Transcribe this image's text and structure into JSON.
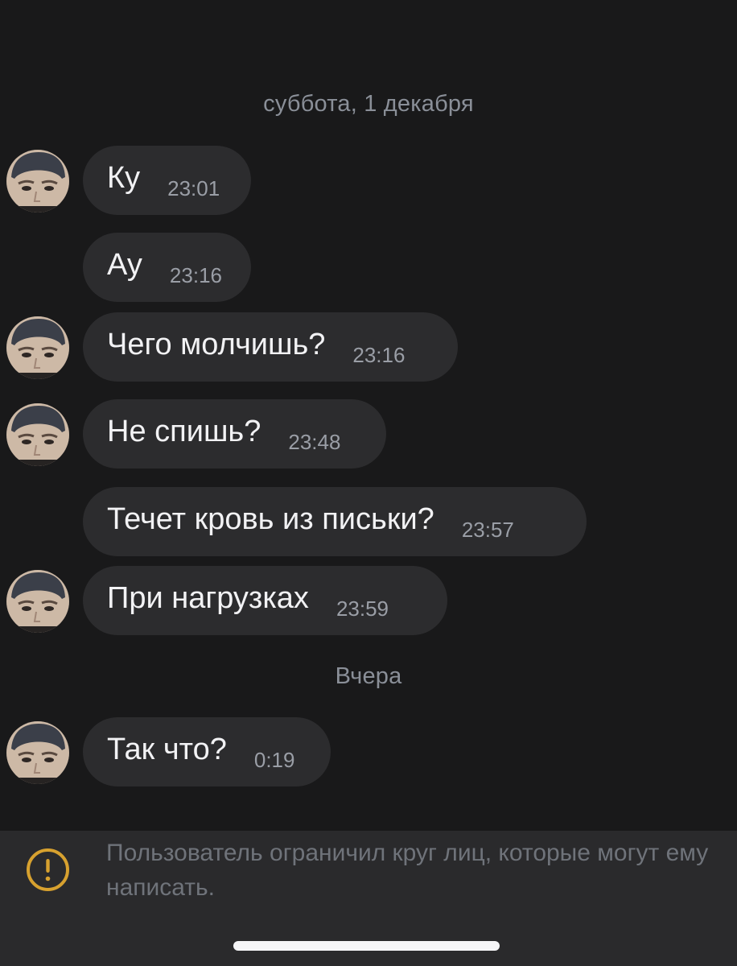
{
  "chat": {
    "separators": {
      "first": "суббота, 1 декабря",
      "second": "Вчера"
    },
    "messages": [
      {
        "text": "Ку",
        "time": "23:01",
        "avatar": true
      },
      {
        "text": "Ау",
        "time": "23:16",
        "avatar": false
      },
      {
        "text": "Чего молчишь?",
        "time": "23:16",
        "avatar": true
      },
      {
        "text": "Не спишь?",
        "time": "23:48",
        "avatar": true
      },
      {
        "text": "Течет кровь из письки?",
        "time": "23:57",
        "avatar": false
      },
      {
        "text": "При нагрузках",
        "time": "23:59",
        "avatar": true
      },
      {
        "text": "Так что?",
        "time": "0:19",
        "avatar": true
      }
    ]
  },
  "footer": {
    "icon": "exclamation-circle-icon",
    "notice": "Пользователь ограничил круг лиц, которые могут ему написать."
  },
  "colors": {
    "background": "#19191a",
    "bubble": "#2c2c2e",
    "footer": "#2a2a2c",
    "warning": "#d7a12f"
  }
}
